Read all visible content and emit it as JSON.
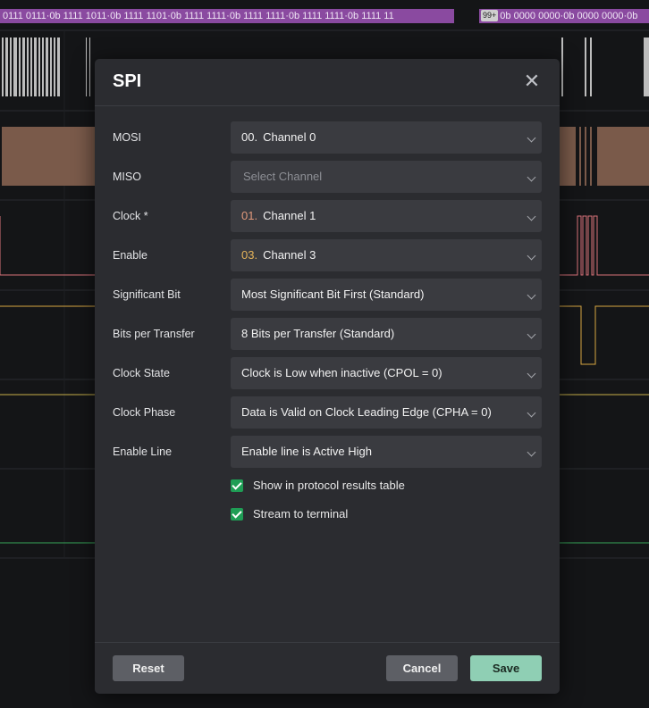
{
  "background": {
    "protocol_text_left": "0111 0111·0b 1111 1011·0b 1111 1101·0b 1111 1111·0b 1111 1111·0b 1111 1111·0b 1111 11",
    "overflow_badge": "99+",
    "protocol_text_right": "0b 0000 0000·0b 0000 0000·0b",
    "colors": {
      "protocol": "#8a4aa0",
      "mosi_block": "#7a5a4a",
      "clock": "#d9727a",
      "enable": "#d8a742",
      "green_line": "#37a85a"
    }
  },
  "dialog": {
    "title": "SPI",
    "close_icon": "close-icon",
    "fields": [
      {
        "label": "MOSI",
        "channel_num": "00.",
        "value": "Channel 0"
      },
      {
        "label": "MISO",
        "placeholder": "Select Channel"
      },
      {
        "label": "Clock *",
        "channel_num": "01.",
        "value": "Channel 1"
      },
      {
        "label": "Enable",
        "channel_num": "03.",
        "value": "Channel 3"
      },
      {
        "label": "Significant Bit",
        "value": "Most Significant Bit First (Standard)"
      },
      {
        "label": "Bits per Transfer",
        "value": "8 Bits per Transfer (Standard)"
      },
      {
        "label": "Clock State",
        "value": "Clock is Low when inactive (CPOL = 0)"
      },
      {
        "label": "Clock Phase",
        "value": "Data is Valid on Clock Leading Edge (CPHA = 0)"
      },
      {
        "label": "Enable Line",
        "value": "Enable line is Active High"
      }
    ],
    "checkboxes": [
      {
        "label": "Show in protocol results table",
        "checked": true
      },
      {
        "label": "Stream to terminal",
        "checked": true
      }
    ],
    "buttons": {
      "reset": "Reset",
      "cancel": "Cancel",
      "save": "Save"
    },
    "colors": {
      "accent_save": "#8fcfb4",
      "checkbox": "#1f9d55",
      "clock_channel": "#e39a7c",
      "enable_channel": "#e6b45a"
    }
  }
}
